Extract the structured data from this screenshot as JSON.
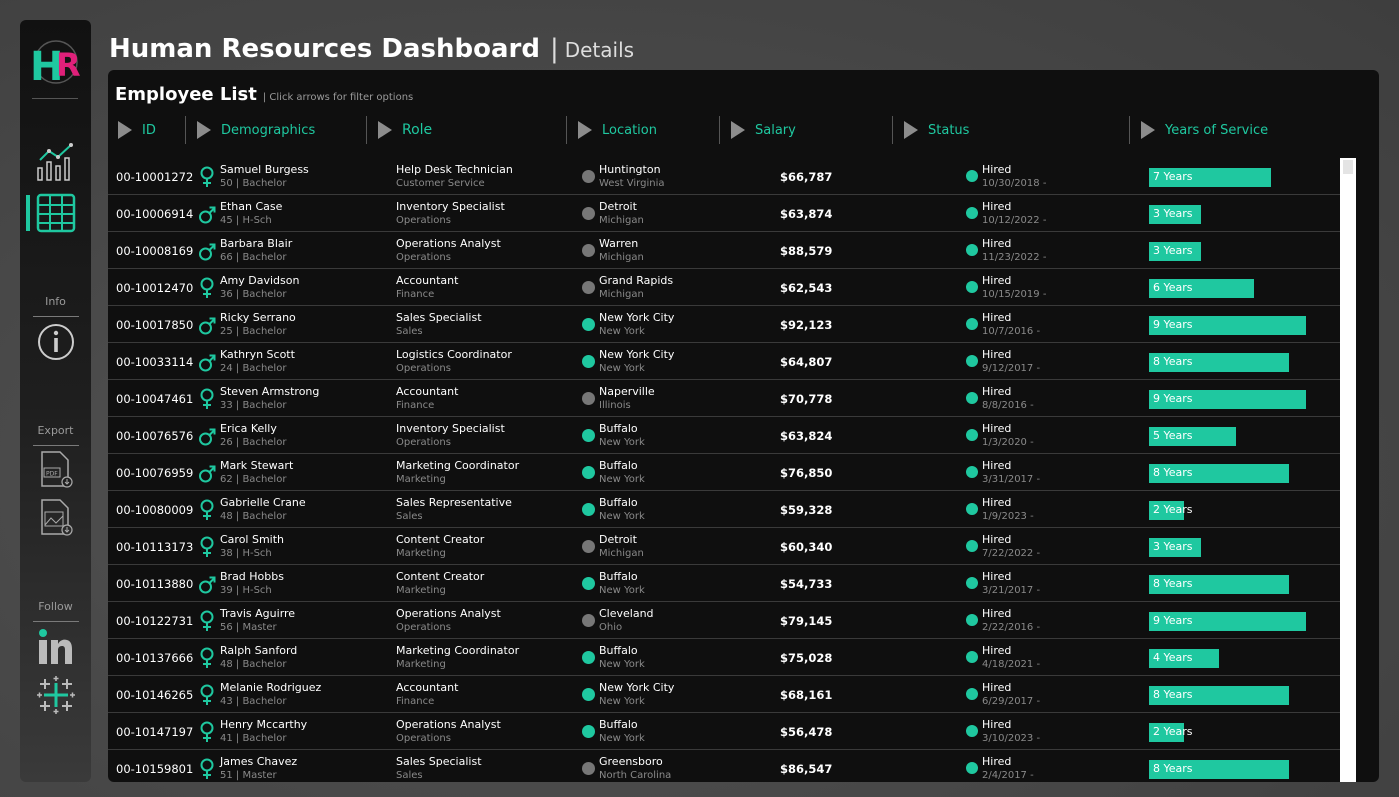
{
  "header": {
    "title": "Human Resources Dashboard",
    "separator": "|",
    "subtitle": "Details"
  },
  "sidebar": {
    "logo_text": "HR",
    "logo_colors": {
      "H": "#1fc8a0",
      "R": "#e0207a"
    },
    "nav": [
      {
        "icon": "bar-chart-icon",
        "active": false
      },
      {
        "icon": "table-icon",
        "active": true
      }
    ],
    "info_label": "Info",
    "export_label": "Export",
    "follow_label": "Follow"
  },
  "panel": {
    "title": "Employee List",
    "hint": "| Click arrows for filter options",
    "columns": [
      "ID",
      "Demographics",
      "Role",
      "Location",
      "Salary",
      "Status",
      "Years of Service"
    ]
  },
  "colors": {
    "accent": "#1fc8a0",
    "inactive_location": "#777777",
    "background": "#0f0f0f"
  },
  "employees": [
    {
      "id": "00-10001272",
      "gender": "female",
      "name": "Samuel Burgess",
      "demo": "50 | Bachelor",
      "role": "Help Desk Technician",
      "dept": "Customer Service",
      "loc_dot": "gray",
      "city": "Huntington",
      "state": "West Virginia",
      "salary": "$66,787",
      "status": "Hired",
      "date": "10/30/2018 -",
      "years_label": "7 Years",
      "years": 7
    },
    {
      "id": "00-10006914",
      "gender": "male",
      "name": "Ethan Case",
      "demo": "45 | H-Sch",
      "role": "Inventory Specialist",
      "dept": "Operations",
      "loc_dot": "gray",
      "city": "Detroit",
      "state": "Michigan",
      "salary": "$63,874",
      "status": "Hired",
      "date": "10/12/2022 -",
      "years_label": "3 Years",
      "years": 3
    },
    {
      "id": "00-10008169",
      "gender": "male",
      "name": "Barbara Blair",
      "demo": "66 | Bachelor",
      "role": "Operations Analyst",
      "dept": "Operations",
      "loc_dot": "gray",
      "city": "Warren",
      "state": "Michigan",
      "salary": "$88,579",
      "status": "Hired",
      "date": "11/23/2022 -",
      "years_label": "3 Years",
      "years": 3
    },
    {
      "id": "00-10012470",
      "gender": "female",
      "name": "Amy Davidson",
      "demo": "36 | Bachelor",
      "role": "Accountant",
      "dept": "Finance",
      "loc_dot": "gray",
      "city": "Grand Rapids",
      "state": "Michigan",
      "salary": "$62,543",
      "status": "Hired",
      "date": "10/15/2019 -",
      "years_label": "6 Years",
      "years": 6
    },
    {
      "id": "00-10017850",
      "gender": "male",
      "name": "Ricky Serrano",
      "demo": "25 | Bachelor",
      "role": "Sales Specialist",
      "dept": "Sales",
      "loc_dot": "green",
      "city": "New York City",
      "state": "New York",
      "salary": "$92,123",
      "status": "Hired",
      "date": "10/7/2016 -",
      "years_label": "9 Years",
      "years": 9
    },
    {
      "id": "00-10033114",
      "gender": "male",
      "name": "Kathryn Scott",
      "demo": "24 | Bachelor",
      "role": "Logistics Coordinator",
      "dept": "Operations",
      "loc_dot": "green",
      "city": "New York City",
      "state": "New York",
      "salary": "$64,807",
      "status": "Hired",
      "date": "9/12/2017 -",
      "years_label": "8 Years",
      "years": 8
    },
    {
      "id": "00-10047461",
      "gender": "female",
      "name": "Steven Armstrong",
      "demo": "33 | Bachelor",
      "role": "Accountant",
      "dept": "Finance",
      "loc_dot": "gray",
      "city": "Naperville",
      "state": "Illinois",
      "salary": "$70,778",
      "status": "Hired",
      "date": "8/8/2016 -",
      "years_label": "9 Years",
      "years": 9
    },
    {
      "id": "00-10076576",
      "gender": "male",
      "name": "Erica Kelly",
      "demo": "26 | Bachelor",
      "role": "Inventory Specialist",
      "dept": "Operations",
      "loc_dot": "green",
      "city": "Buffalo",
      "state": "New York",
      "salary": "$63,824",
      "status": "Hired",
      "date": "1/3/2020 -",
      "years_label": "5 Years",
      "years": 5
    },
    {
      "id": "00-10076959",
      "gender": "male",
      "name": "Mark Stewart",
      "demo": "62 | Bachelor",
      "role": "Marketing Coordinator",
      "dept": "Marketing",
      "loc_dot": "green",
      "city": "Buffalo",
      "state": "New York",
      "salary": "$76,850",
      "status": "Hired",
      "date": "3/31/2017 -",
      "years_label": "8 Years",
      "years": 8
    },
    {
      "id": "00-10080009",
      "gender": "female",
      "name": "Gabrielle Crane",
      "demo": "48 | Bachelor",
      "role": "Sales Representative",
      "dept": "Sales",
      "loc_dot": "green",
      "city": "Buffalo",
      "state": "New York",
      "salary": "$59,328",
      "status": "Hired",
      "date": "1/9/2023 -",
      "years_label": "2 Years",
      "years": 2
    },
    {
      "id": "00-10113173",
      "gender": "female",
      "name": "Carol Smith",
      "demo": "38 | H-Sch",
      "role": "Content Creator",
      "dept": "Marketing",
      "loc_dot": "gray",
      "city": "Detroit",
      "state": "Michigan",
      "salary": "$60,340",
      "status": "Hired",
      "date": "7/22/2022 -",
      "years_label": "3 Years",
      "years": 3
    },
    {
      "id": "00-10113880",
      "gender": "male",
      "name": "Brad Hobbs",
      "demo": "39 | H-Sch",
      "role": "Content Creator",
      "dept": "Marketing",
      "loc_dot": "green",
      "city": "Buffalo",
      "state": "New York",
      "salary": "$54,733",
      "status": "Hired",
      "date": "3/21/2017 -",
      "years_label": "8 Years",
      "years": 8
    },
    {
      "id": "00-10122731",
      "gender": "female",
      "name": "Travis Aguirre",
      "demo": "56 | Master",
      "role": "Operations Analyst",
      "dept": "Operations",
      "loc_dot": "gray",
      "city": "Cleveland",
      "state": "Ohio",
      "salary": "$79,145",
      "status": "Hired",
      "date": "2/22/2016 -",
      "years_label": "9 Years",
      "years": 9
    },
    {
      "id": "00-10137666",
      "gender": "female",
      "name": "Ralph Sanford",
      "demo": "48 | Bachelor",
      "role": "Marketing Coordinator",
      "dept": "Marketing",
      "loc_dot": "green",
      "city": "Buffalo",
      "state": "New York",
      "salary": "$75,028",
      "status": "Hired",
      "date": "4/18/2021 -",
      "years_label": "4 Years",
      "years": 4
    },
    {
      "id": "00-10146265",
      "gender": "female",
      "name": "Melanie Rodriguez",
      "demo": "43 | Bachelor",
      "role": "Accountant",
      "dept": "Finance",
      "loc_dot": "green",
      "city": "New York City",
      "state": "New York",
      "salary": "$68,161",
      "status": "Hired",
      "date": "6/29/2017 -",
      "years_label": "8 Years",
      "years": 8
    },
    {
      "id": "00-10147197",
      "gender": "female",
      "name": "Henry Mccarthy",
      "demo": "41 | Bachelor",
      "role": "Operations Analyst",
      "dept": "Operations",
      "loc_dot": "green",
      "city": "Buffalo",
      "state": "New York",
      "salary": "$56,478",
      "status": "Hired",
      "date": "3/10/2023 -",
      "years_label": "2 Years",
      "years": 2
    },
    {
      "id": "00-10159801",
      "gender": "female",
      "name": "James Chavez",
      "demo": "51 | Master",
      "role": "Sales Specialist",
      "dept": "Sales",
      "loc_dot": "gray",
      "city": "Greensboro",
      "state": "North Carolina",
      "salary": "$86,547",
      "status": "Hired",
      "date": "2/4/2017 -",
      "years_label": "8 Years",
      "years": 8
    }
  ]
}
